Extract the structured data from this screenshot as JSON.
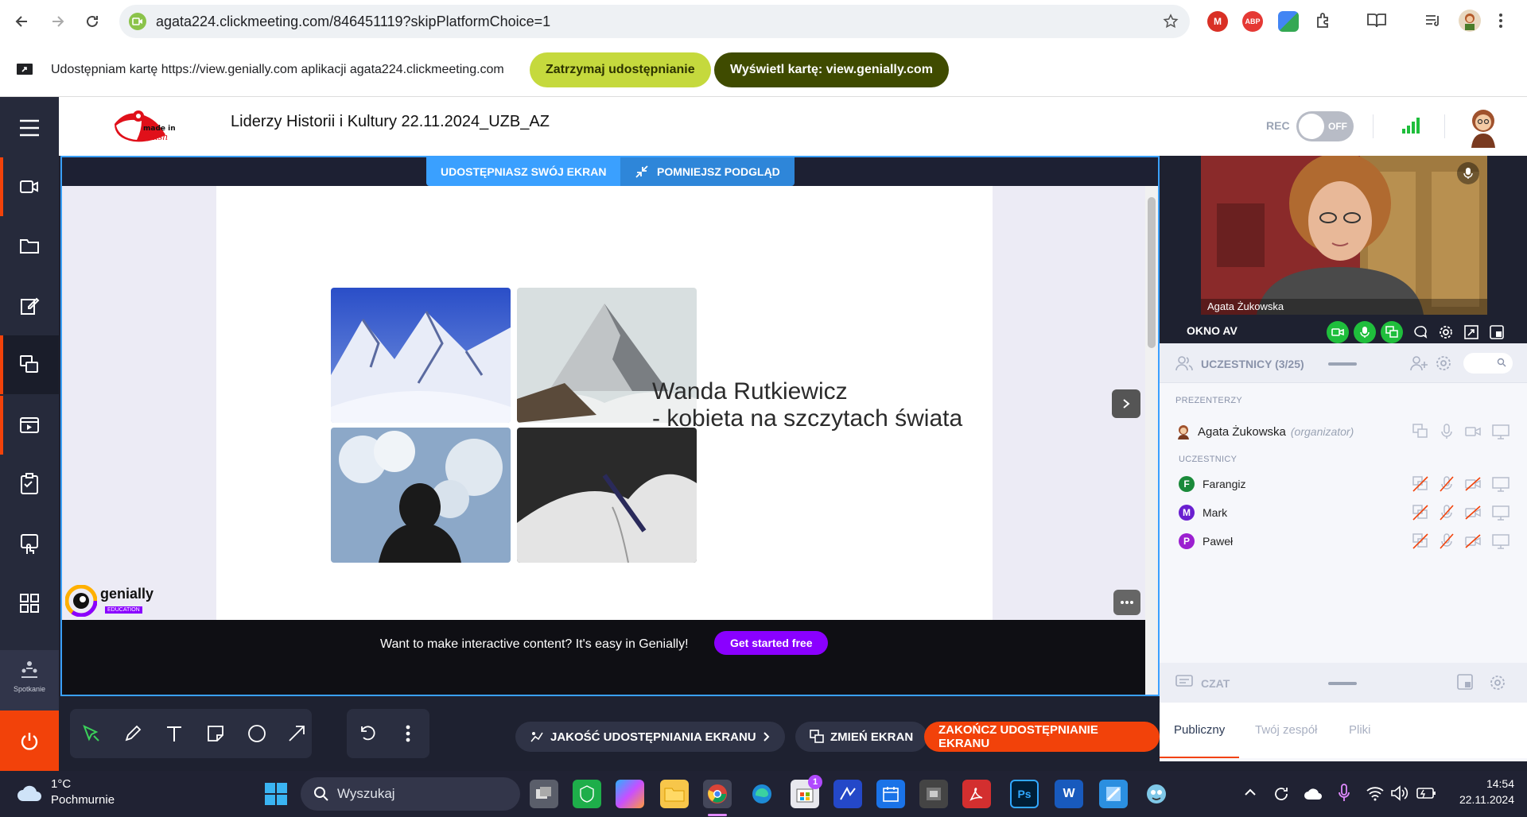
{
  "browser": {
    "url": "agata224.clickmeeting.com/846451119?skipPlatformChoice=1",
    "ext_m": "M",
    "ext_abp": "ABP"
  },
  "sharebar": {
    "text": "Udostępniam kartę https://view.genially.com aplikacji agata224.clickmeeting.com",
    "stop_label": "Zatrzymaj udostępnianie",
    "show_label": "Wyświetl kartę: view.genially.com"
  },
  "header": {
    "meeting_title": "Liderzy Historii i Kultury 22.11.2024_UZB_AZ",
    "logo_text": "made in Polish",
    "rec_label": "REC",
    "rec_state": "OFF"
  },
  "sidebar": {
    "bottom_label": "Spotkanie"
  },
  "share": {
    "badge_sharing": "UDOSTĘPNIASZ SWÓJ EKRAN",
    "badge_shrink": "POMNIEJSZ PODGLĄD",
    "slide_title_line1": "Wanda Rutkiewicz",
    "slide_title_line2": "- kobieta na szczytach świata",
    "genially_brand": "genially",
    "genially_sub": "EDUCATION",
    "promo_text": "Want to make interactive content? It's easy in Genially!",
    "promo_button": "Get started free"
  },
  "video": {
    "person_name": "Agata Żukowska",
    "panel_label": "OKNO AV"
  },
  "participants": {
    "header": "UCZESTNICY (3/25)",
    "presenters_label": "PREZENTERZY",
    "presenter_name": "Agata Żukowska",
    "presenter_role": "(organizator)",
    "attendees_label": "UCZESTNICY",
    "attendees": [
      {
        "initial": "F",
        "name": "Farangiz",
        "color": "#1a8a3a"
      },
      {
        "initial": "M",
        "name": "Mark",
        "color": "#6a1fd0"
      },
      {
        "initial": "P",
        "name": "Paweł",
        "color": "#9b1fd0"
      }
    ]
  },
  "chat": {
    "header": "CZAT",
    "tabs": [
      "Publiczny",
      "Twój zespół",
      "Pliki"
    ]
  },
  "bottom": {
    "quality_label": "JAKOŚĆ UDOSTĘPNIANIA EKRANU",
    "change_label": "ZMIEŃ EKRAN",
    "end_label": "ZAKOŃCZ UDOSTĘPNIANIE EKRANU"
  },
  "taskbar": {
    "temp": "1°C",
    "weather": "Pochmurnie",
    "search_placeholder": "Wyszukaj",
    "time": "14:54",
    "date": "22.11.2024",
    "store_badge": "1",
    "ps_label": "Ps",
    "word_label": "W"
  },
  "colors": {
    "accent_blue": "#3aa0ff",
    "accent_orange": "#f2420a",
    "share_green": "#c5d93d",
    "share_dark": "#3f4b00"
  }
}
